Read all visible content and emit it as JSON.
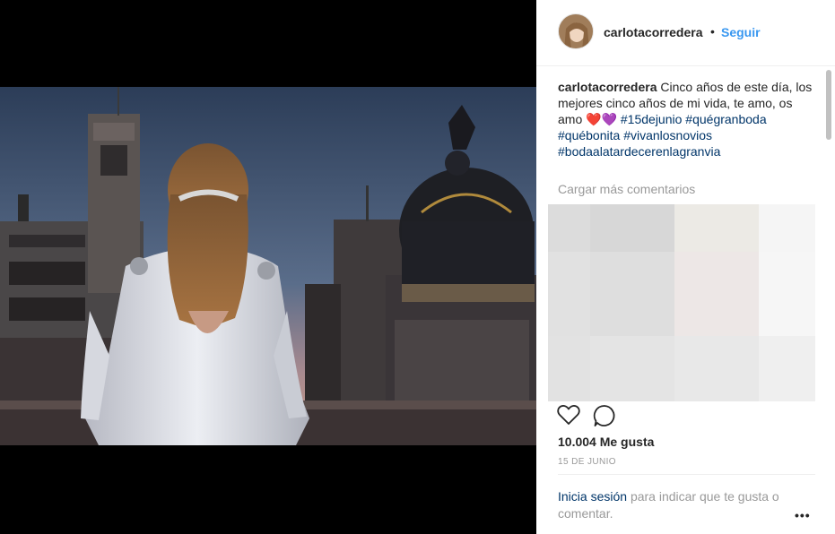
{
  "post": {
    "username": "carlotacorredera",
    "separator": "•",
    "follow_label": "Seguir",
    "caption": {
      "username": "carlotacorredera",
      "text": "Cinco años de este día, los mejores cinco años de mi vida, te amo, os amo",
      "emoji": "❤️💜",
      "hashtags": [
        "#15dejunio",
        "#quégranboda",
        "#québonita",
        "#vivanlosnovios",
        "#bodaalatardecerenlagranvia"
      ]
    },
    "load_more": "Cargar más comentarios",
    "likes": "10.004 Me gusta",
    "date": "15 DE JUNIO",
    "login_prompt": {
      "link": "Inicia sesión",
      "rest": "para indicar que te gusta o comentar."
    },
    "more_options": "•••"
  },
  "blur_colors": [
    "#dcdcdc",
    "#d7d7d7",
    "#eceae5",
    "#f5f5f5",
    "#e1e1e1",
    "#dedede",
    "#ede7e6",
    "#f6f6f6",
    "#e2e2e2",
    "#e4e4e4",
    "#e8e8e8",
    "#efefef"
  ],
  "colors": {
    "link": "#3897f0",
    "hashtag": "#003569",
    "muted": "#999999",
    "text": "#262626"
  }
}
